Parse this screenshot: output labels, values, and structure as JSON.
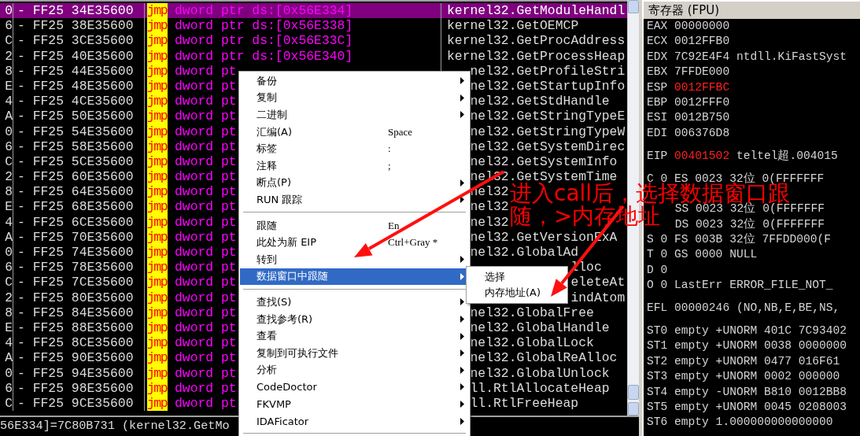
{
  "disassembly": {
    "rows": [
      {
        "addr": "0",
        "hex": "- FF25 34E35600",
        "mnemonic": "jmp",
        "operand": "dword ptr ds:[0x56E334]",
        "comment": "kernel32.GetModuleHandl",
        "kind": "full",
        "selected": true
      },
      {
        "addr": "6",
        "hex": "- FF25 38E35600",
        "mnemonic": "jmp",
        "operand": "dword ptr ds:[0x56E338]",
        "comment": "kernel32.GetOEMCP",
        "kind": "full",
        "selected": false
      },
      {
        "addr": "C",
        "hex": "- FF25 3CE35600",
        "mnemonic": "jmp",
        "operand": "dword ptr ds:[0x56E33C]",
        "comment": "kernel32.GetProcAddress",
        "kind": "full",
        "selected": false
      },
      {
        "addr": "2",
        "hex": "- FF25 40E35600",
        "mnemonic": "jmp",
        "operand": "dword ptr ds:[0x56E340]",
        "comment": "kernel32.GetProcessHeap",
        "kind": "full",
        "selected": false
      },
      {
        "addr": "8",
        "hex": "- FF25 44E35600",
        "mnemonic": "jmp",
        "operand": "dword pt",
        "comment": "nel32.GetProfileStri",
        "kind": "menu",
        "selected": false
      },
      {
        "addr": "E",
        "hex": "- FF25 48E35600",
        "mnemonic": "jmp",
        "operand": "dword pt",
        "comment": "nel32.GetStartupInfo",
        "kind": "menu",
        "selected": false
      },
      {
        "addr": "4",
        "hex": "- FF25 4CE35600",
        "mnemonic": "jmp",
        "operand": "dword pt",
        "comment": "nel32.GetStdHandle",
        "kind": "menu",
        "selected": false
      },
      {
        "addr": "A",
        "hex": "- FF25 50E35600",
        "mnemonic": "jmp",
        "operand": "dword pt",
        "comment": "nel32.GetStringTypeE",
        "kind": "menu",
        "selected": false
      },
      {
        "addr": "0",
        "hex": "- FF25 54E35600",
        "mnemonic": "jmp",
        "operand": "dword pt",
        "comment": "nel32.GetStringTypeW",
        "kind": "menu",
        "selected": false
      },
      {
        "addr": "6",
        "hex": "- FF25 58E35600",
        "mnemonic": "jmp",
        "operand": "dword pt",
        "comment": "nel32.GetSystemDirec",
        "kind": "menu",
        "selected": false
      },
      {
        "addr": "C",
        "hex": "- FF25 5CE35600",
        "mnemonic": "jmp",
        "operand": "dword pt",
        "comment": "nel32.GetSystemInfo",
        "kind": "menu",
        "selected": false
      },
      {
        "addr": "2",
        "hex": "- FF25 60E35600",
        "mnemonic": "jmp",
        "operand": "dword pt",
        "comment": "nel32.GetSystemTime",
        "kind": "menu",
        "selected": false
      },
      {
        "addr": "8",
        "hex": "- FF25 64E35600",
        "mnemonic": "jmp",
        "operand": "dword pt",
        "comment": "nel32",
        "kind": "menu",
        "selected": false
      },
      {
        "addr": "E",
        "hex": "- FF25 68E35600",
        "mnemonic": "jmp",
        "operand": "dword pt",
        "comment": "nel32",
        "kind": "menu",
        "selected": false
      },
      {
        "addr": "4",
        "hex": "- FF25 6CE35600",
        "mnemonic": "jmp",
        "operand": "dword pt",
        "comment": "nel32",
        "kind": "menu",
        "selected": false
      },
      {
        "addr": "A",
        "hex": "- FF25 70E35600",
        "mnemonic": "jmp",
        "operand": "dword pt",
        "comment": "nel32.GetVersionExA",
        "kind": "menu",
        "selected": false
      },
      {
        "addr": "0",
        "hex": "- FF25 74E35600",
        "mnemonic": "jmp",
        "operand": "dword pt",
        "comment": "nel32.GlobalAd",
        "kind": "menu",
        "selected": false
      },
      {
        "addr": "6",
        "hex": "- FF25 78E35600",
        "mnemonic": "jmp",
        "operand": "dword pt",
        "comment": "lloc",
        "kind": "submenu",
        "selected": false
      },
      {
        "addr": "C",
        "hex": "- FF25 7CE35600",
        "mnemonic": "jmp",
        "operand": "dword pt",
        "comment": "eleteAt",
        "kind": "submenu",
        "selected": false
      },
      {
        "addr": "2",
        "hex": "- FF25 80E35600",
        "mnemonic": "jmp",
        "operand": "dword pt",
        "comment": "indAtom",
        "kind": "submenu",
        "selected": false
      },
      {
        "addr": "8",
        "hex": "- FF25 84E35600",
        "mnemonic": "jmp",
        "operand": "dword pt",
        "comment": "nel32.GlobalFree",
        "kind": "menu",
        "selected": false
      },
      {
        "addr": "E",
        "hex": "- FF25 88E35600",
        "mnemonic": "jmp",
        "operand": "dword pt",
        "comment": "nel32.GlobalHandle",
        "kind": "menu",
        "selected": false
      },
      {
        "addr": "4",
        "hex": "- FF25 8CE35600",
        "mnemonic": "jmp",
        "operand": "dword pt",
        "comment": "nel32.GlobalLock",
        "kind": "menu",
        "selected": false
      },
      {
        "addr": "A",
        "hex": "- FF25 90E35600",
        "mnemonic": "jmp",
        "operand": "dword pt",
        "comment": "nel32.GlobalReAlloc",
        "kind": "menu",
        "selected": false
      },
      {
        "addr": "0",
        "hex": "- FF25 94E35600",
        "mnemonic": "jmp",
        "operand": "dword pt",
        "comment": "nel32.GlobalUnlock",
        "kind": "menu",
        "selected": false
      },
      {
        "addr": "6",
        "hex": "- FF25 98E35600",
        "mnemonic": "jmp",
        "operand": "dword pt",
        "comment": "ll.RtlAllocateHeap",
        "kind": "menu",
        "selected": false
      },
      {
        "addr": "C",
        "hex": "- FF25 9CE35600",
        "mnemonic": "jmp",
        "operand": "dword pt",
        "comment": "ll.RtlFreeHeap",
        "kind": "menu",
        "selected": false
      }
    ]
  },
  "info_line": "56E334]=7C80B731 (kernel32.GetMo",
  "registers": {
    "title": "寄存器 (FPU)",
    "groups": [
      [
        {
          "label": "EAX",
          "value": "00000000",
          "changed": false
        },
        {
          "label": "ECX",
          "value": "0012FFB0",
          "changed": false
        },
        {
          "label": "EDX",
          "value": "7C92E4F4",
          "note": "ntdll.KiFastSyst",
          "changed": false
        },
        {
          "label": "EBX",
          "value": "7FFDE000",
          "changed": false
        },
        {
          "label": "ESP",
          "value": "0012FFBC",
          "changed": true
        },
        {
          "label": "EBP",
          "value": "0012FFF0",
          "changed": false
        },
        {
          "label": "ESI",
          "value": "0012B750",
          "changed": false
        },
        {
          "label": "EDI",
          "value": "006376D8",
          "changed": false
        }
      ],
      [
        {
          "label": "EIP",
          "value": "00401502",
          "note": "teltel超.004015",
          "changed": true
        }
      ],
      [
        {
          "label": "C 0",
          "value": "ES 0023 32位 0(FFFFFFF",
          "changed": false
        },
        {
          "kind": "covered"
        },
        {
          "value": "SS 0023 32位 0(FFFFFFF",
          "changed": false
        },
        {
          "value": "DS 0023 32位 0(FFFFFFF",
          "changed": false
        },
        {
          "label": "S 0",
          "value": "FS 003B 32位 7FFDD000(F",
          "changed": false
        },
        {
          "label": "T 0",
          "value": "GS 0000 NULL",
          "changed": false
        },
        {
          "label": "D 0",
          "changed": false
        },
        {
          "label": "O 0",
          "value": "LastErr ERROR_FILE_NOT_",
          "changed": false
        }
      ],
      [
        {
          "label": "EFL",
          "value": "00000246 (NO,NB,E,BE,NS,",
          "changed": false
        }
      ],
      [
        {
          "label": "ST0",
          "value": "empty +UNORM 401C 7C93402",
          "changed": false
        },
        {
          "label": "ST1",
          "value": "empty +UNORM 0038 0000000",
          "changed": false
        },
        {
          "label": "ST2",
          "value": "empty +UNORM 0477 016F61",
          "changed": false
        },
        {
          "label": "ST3",
          "value": "empty +UNORM 0002 000000",
          "changed": false
        },
        {
          "label": "ST4",
          "value": "empty -UNORM B810 0012BB8",
          "changed": false
        },
        {
          "label": "ST5",
          "value": "empty +UNORM 0045 0208003",
          "changed": false
        },
        {
          "label": "ST6",
          "value": "empty 1.000000000000000",
          "changed": false
        }
      ]
    ]
  },
  "context_menu": {
    "items": [
      {
        "kind": "item",
        "label": "备份",
        "submenu": true,
        "selected": false
      },
      {
        "kind": "item",
        "label": "复制",
        "submenu": true,
        "selected": false
      },
      {
        "kind": "item",
        "label": "二进制",
        "submenu": true,
        "selected": false
      },
      {
        "kind": "item",
        "label": "汇编(A)",
        "shortcut": "Space",
        "submenu": false,
        "selected": false
      },
      {
        "kind": "item",
        "label": "标签",
        "shortcut": ":",
        "submenu": false,
        "selected": false
      },
      {
        "kind": "item",
        "label": "注释",
        "shortcut": ";",
        "submenu": false,
        "selected": false
      },
      {
        "kind": "item",
        "label": "断点(P)",
        "submenu": true,
        "selected": false
      },
      {
        "kind": "item",
        "label": "RUN 跟踪",
        "submenu": true,
        "selected": false
      },
      {
        "kind": "separator"
      },
      {
        "kind": "item",
        "label": "跟随",
        "shortcut": "En",
        "submenu": false,
        "selected": false
      },
      {
        "kind": "item",
        "label": "此处为新 EIP",
        "shortcut": "Ctrl+Gray *",
        "submenu": false,
        "selected": false
      },
      {
        "kind": "item",
        "label": "转到",
        "submenu": true,
        "selected": false
      },
      {
        "kind": "item",
        "label": "数据窗口中跟随",
        "submenu": true,
        "selected": true
      },
      {
        "kind": "separator"
      },
      {
        "kind": "item",
        "label": "查找(S)",
        "submenu": true,
        "selected": false
      },
      {
        "kind": "item",
        "label": "查找参考(R)",
        "submenu": true,
        "selected": false
      },
      {
        "kind": "item",
        "label": "查看",
        "submenu": true,
        "selected": false
      },
      {
        "kind": "item",
        "label": "复制到可执行文件",
        "submenu": true,
        "selected": false
      },
      {
        "kind": "item",
        "label": "分析",
        "submenu": true,
        "selected": false
      },
      {
        "kind": "item",
        "label": "CodeDoctor",
        "submenu": true,
        "selected": false
      },
      {
        "kind": "item",
        "label": "FKVMP",
        "submenu": true,
        "selected": false
      },
      {
        "kind": "item",
        "label": "IDAFicator",
        "submenu": true,
        "selected": false
      },
      {
        "kind": "separator"
      }
    ]
  },
  "submenu": {
    "items": [
      {
        "label": "选择",
        "selected": false
      },
      {
        "label": "内存地址(A)",
        "selected": false
      }
    ]
  },
  "annotation": {
    "lines": [
      "进入call后，选择数据窗口跟",
      "随，>内存地址"
    ]
  }
}
